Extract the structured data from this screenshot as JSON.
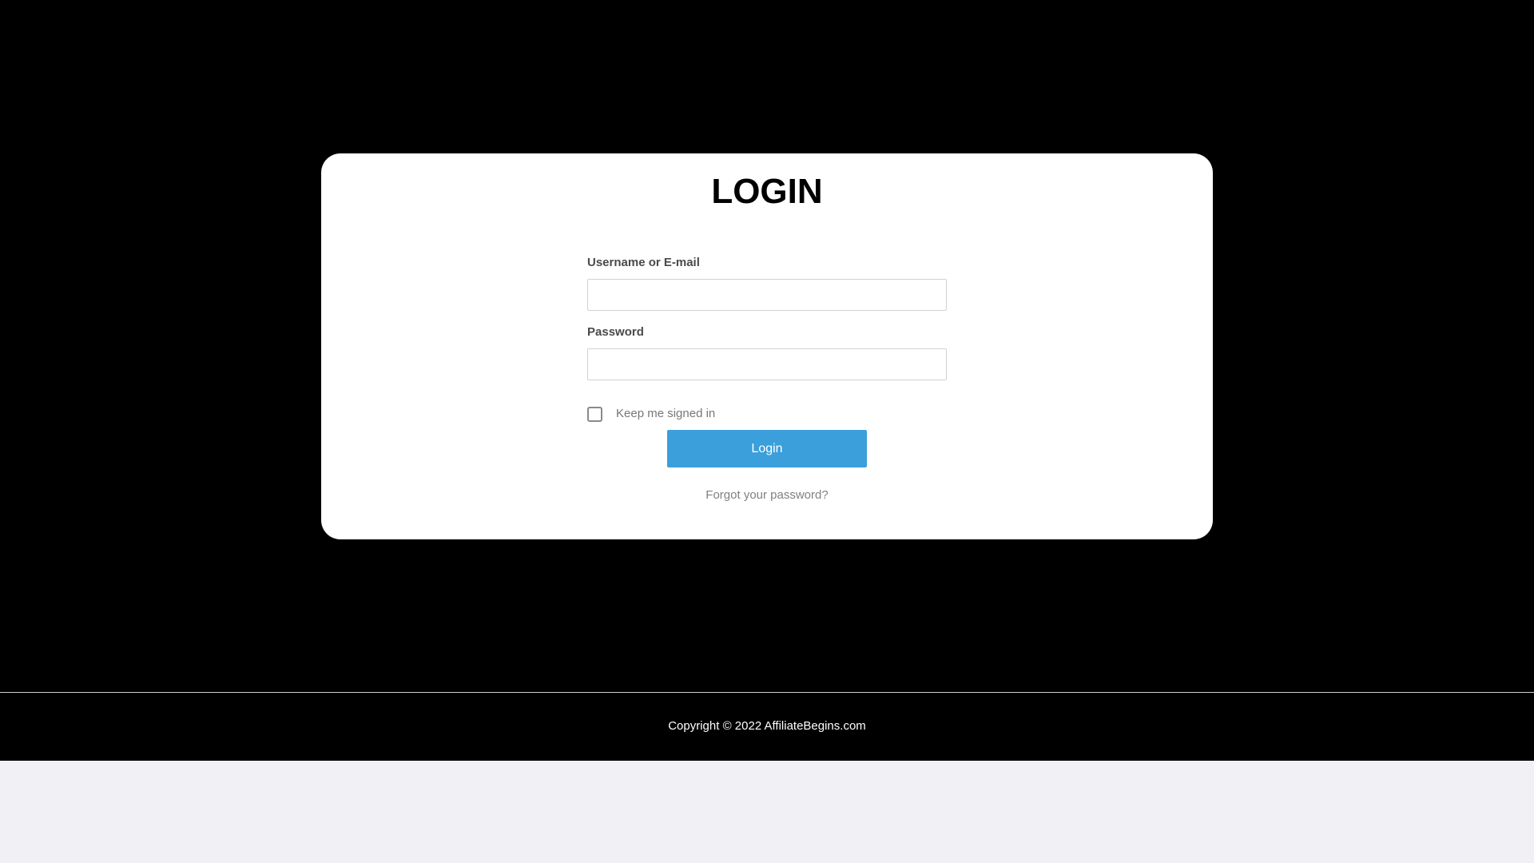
{
  "login": {
    "title": "LOGIN",
    "username_label": "Username or E-mail",
    "username_value": "",
    "password_label": "Password",
    "password_value": "",
    "remember_label": "Keep me signed in",
    "remember_checked": false,
    "submit_label": "Login",
    "forgot_label": "Forgot your password?"
  },
  "footer": {
    "copyright": "Copyright © 2022 AffiliateBegins.com"
  },
  "colors": {
    "page_background": "#000000",
    "card_background": "#ffffff",
    "button_accent": "#3a9fdb",
    "below_page_background": "#f1f0f5"
  }
}
